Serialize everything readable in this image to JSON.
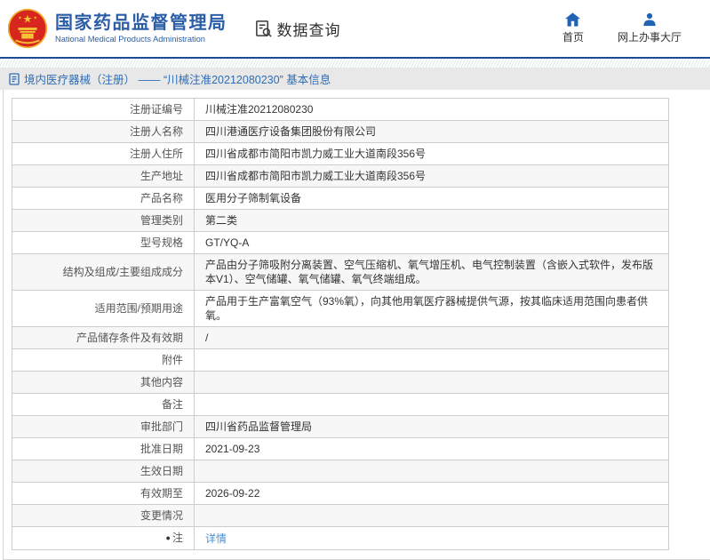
{
  "header": {
    "title": "国家药品监督管理局",
    "subtitle": "National Medical Products Administration",
    "section_label": "数据查询",
    "nav": [
      {
        "icon": "home-icon",
        "label": "首页"
      },
      {
        "icon": "user-icon",
        "label": "网上办事大厅"
      }
    ]
  },
  "breadcrumb": {
    "icon": "document-icon",
    "text": "境内医疗器械（注册） —— “川械注准20212080230” 基本信息"
  },
  "table": {
    "rows": [
      {
        "label": "注册证编号",
        "value": "川械注准20212080230"
      },
      {
        "label": "注册人名称",
        "value": "四川港通医疗设备集团股份有限公司"
      },
      {
        "label": "注册人住所",
        "value": "四川省成都市简阳市凯力威工业大道南段356号"
      },
      {
        "label": "生产地址",
        "value": "四川省成都市简阳市凯力威工业大道南段356号"
      },
      {
        "label": "产品名称",
        "value": "医用分子筛制氧设备"
      },
      {
        "label": "管理类别",
        "value": "第二类"
      },
      {
        "label": "型号规格",
        "value": "GT/YQ-A"
      },
      {
        "label": "结构及组成/主要组成成分",
        "value": "产品由分子筛吸附分离装置、空气压缩机、氧气增压机、电气控制装置（含嵌入式软件，发布版本V1）、空气储罐、氧气储罐、氧气终端组成。"
      },
      {
        "label": "适用范围/预期用途",
        "value": "产品用于生产富氧空气（93%氧），向其他用氧医疗器械提供气源，按其临床适用范围向患者供氧。"
      },
      {
        "label": "产品储存条件及有效期",
        "value": "/"
      },
      {
        "label": "附件",
        "value": ""
      },
      {
        "label": "其他内容",
        "value": ""
      },
      {
        "label": "备注",
        "value": ""
      },
      {
        "label": "审批部门",
        "value": "四川省药品监督管理局"
      },
      {
        "label": "批准日期",
        "value": "2021-09-23"
      },
      {
        "label": "生效日期",
        "value": ""
      },
      {
        "label": "有效期至",
        "value": "2026-09-22"
      },
      {
        "label": "变更情况",
        "value": ""
      },
      {
        "label": "注",
        "label_icon": "●",
        "value": "详情"
      }
    ]
  },
  "colors": {
    "brand_blue": "#2b5ea7",
    "header_line": "#1b4c96",
    "breadcrumb_text": "#2e6cb5",
    "link_blue": "#4a90d9",
    "row_alt": "#f7f7f7",
    "table_border": "#cccccc",
    "emblem_red": "#d7261d",
    "emblem_gold": "#f0b429"
  }
}
